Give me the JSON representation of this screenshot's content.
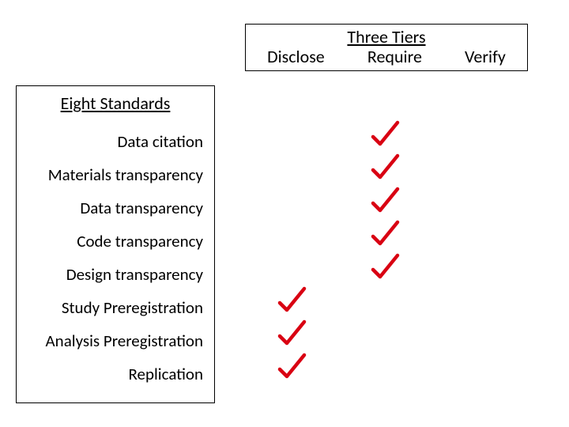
{
  "tiers": {
    "title": "Three Tiers",
    "labels": [
      "Disclose",
      "Require",
      "Verify"
    ]
  },
  "standards": {
    "title": "Eight Standards",
    "rows": [
      "Data citation",
      "Materials transparency",
      "Data transparency",
      "Code transparency",
      "Design transparency",
      "Study Preregistration",
      "Analysis Preregistration",
      "Replication"
    ]
  },
  "chart_data": {
    "type": "table",
    "title": "Eight Standards × Three Tiers (checkmarks)",
    "categories": [
      "Disclose",
      "Require",
      "Verify"
    ],
    "series": [
      {
        "name": "Data citation",
        "values": [
          0,
          1,
          0
        ]
      },
      {
        "name": "Materials transparency",
        "values": [
          0,
          1,
          0
        ]
      },
      {
        "name": "Data transparency",
        "values": [
          0,
          1,
          0
        ]
      },
      {
        "name": "Code transparency",
        "values": [
          0,
          1,
          0
        ]
      },
      {
        "name": "Design transparency",
        "values": [
          0,
          1,
          0
        ]
      },
      {
        "name": "Study Preregistration",
        "values": [
          1,
          0,
          0
        ]
      },
      {
        "name": "Analysis Preregistration",
        "values": [
          1,
          0,
          0
        ]
      },
      {
        "name": "Replication",
        "values": [
          1,
          0,
          0
        ]
      }
    ]
  },
  "icons": {
    "check": "check-icon"
  }
}
